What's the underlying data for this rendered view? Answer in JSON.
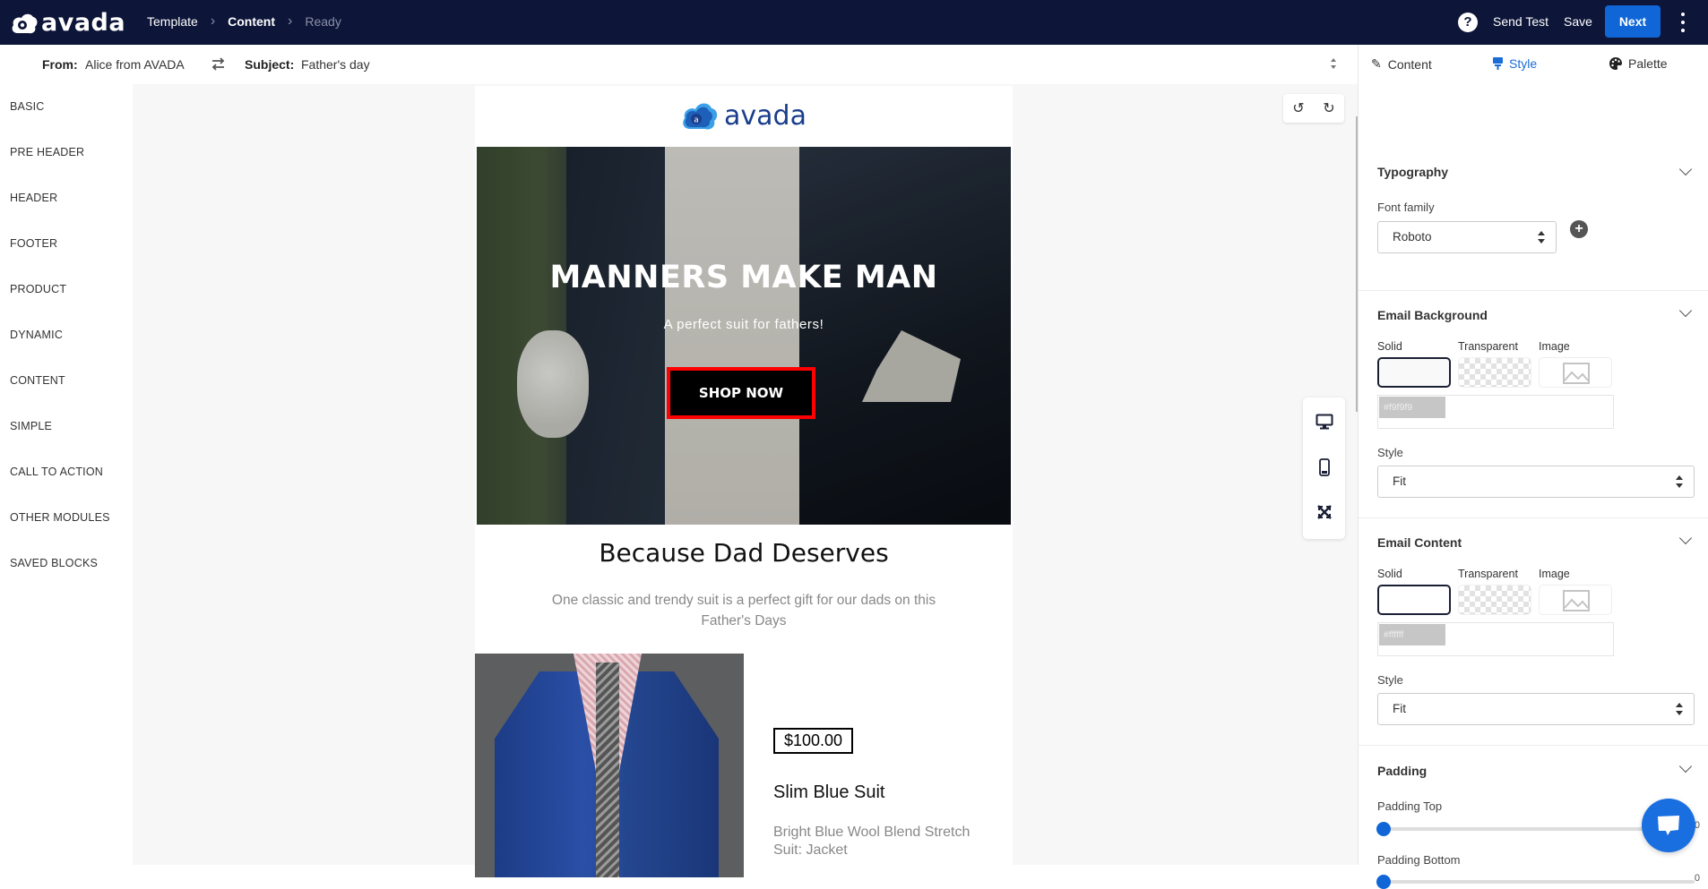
{
  "topbar": {
    "logo_text": "avada",
    "breadcrumbs": [
      {
        "label": "Template",
        "state": "done"
      },
      {
        "label": "Content",
        "state": "active"
      },
      {
        "label": "Ready",
        "state": "pending"
      }
    ],
    "send_test_label": "Send Test",
    "save_label": "Save",
    "next_label": "Next",
    "brand_color": "#1066d6"
  },
  "subbar": {
    "from_label": "From:",
    "from_value": "Alice from AVADA",
    "subject_label": "Subject:",
    "subject_value": "Father's day"
  },
  "sidebar": {
    "items": [
      {
        "label": "BASIC"
      },
      {
        "label": "PRE HEADER"
      },
      {
        "label": "HEADER"
      },
      {
        "label": "FOOTER"
      },
      {
        "label": "PRODUCT"
      },
      {
        "label": "DYNAMIC"
      },
      {
        "label": "CONTENT"
      },
      {
        "label": "SIMPLE"
      },
      {
        "label": "CALL TO ACTION"
      },
      {
        "label": "OTHER MODULES"
      },
      {
        "label": "SAVED BLOCKS"
      }
    ]
  },
  "email": {
    "logo_text": "avada",
    "hero": {
      "title": "MANNERS MAKE MAN",
      "subtitle": "A perfect suit for fathers!",
      "button_label": "SHOP NOW"
    },
    "section_title": "Because Dad Deserves",
    "section_text": "One classic and trendy suit is a perfect gift for our dads on this Father's Days",
    "product": {
      "price": "$100.00",
      "name": "Slim Blue Suit",
      "description": "Bright Blue Wool Blend Stretch Suit: Jacket"
    }
  },
  "right_panel": {
    "tabs": [
      {
        "label": "Content",
        "icon": "pencil-icon",
        "active": false
      },
      {
        "label": "Style",
        "icon": "paint-brush-icon",
        "active": true
      },
      {
        "label": "Palette",
        "icon": "palette-icon",
        "active": false
      }
    ],
    "typography": {
      "title": "Typography",
      "font_family_label": "Font family",
      "font_family_value": "Roboto"
    },
    "email_background": {
      "title": "Email Background",
      "options": [
        "Solid",
        "Transparent",
        "Image"
      ],
      "selected": "Solid",
      "hex": "#f9f9f9",
      "style_label": "Style",
      "style_value": "Fit"
    },
    "email_content": {
      "title": "Email Content",
      "options": [
        "Solid",
        "Transparent",
        "Image"
      ],
      "selected": "Solid",
      "hex": "#ffffff",
      "style_label": "Style",
      "style_value": "Fit"
    },
    "padding": {
      "title": "Padding",
      "top_label": "Padding Top",
      "top_value": "0",
      "bottom_label": "Padding Bottom",
      "bottom_value": "0"
    }
  }
}
